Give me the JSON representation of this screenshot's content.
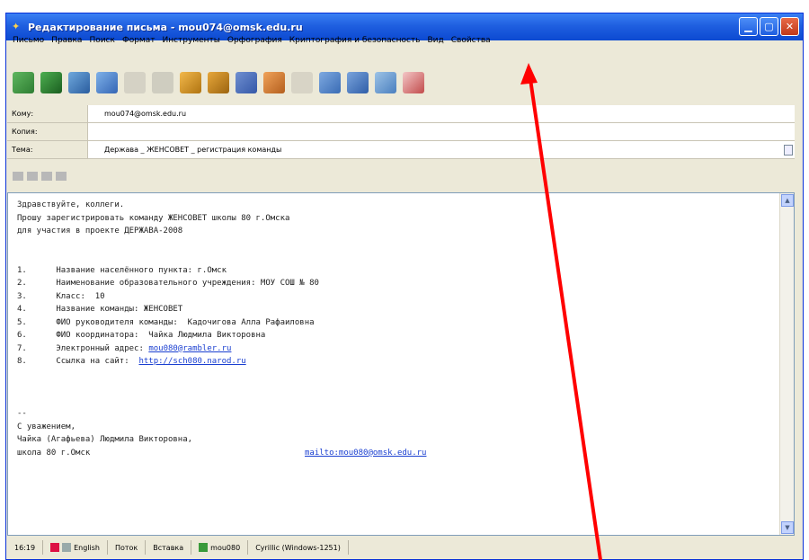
{
  "window": {
    "title": "Редактирование письма - mou074@omsk.edu.ru",
    "controls": [
      "minimize-icon",
      "maximize-icon",
      "close-icon"
    ]
  },
  "menu": [
    "Письмо",
    "Правка",
    "Поиск",
    "Формат",
    "Инструменты",
    "Орфография",
    "Криптография и безопасность",
    "Вид",
    "Свойства"
  ],
  "toolbar": {
    "icons": [
      "send-icon",
      "send-later-icon",
      "address-book-icon",
      "attach-icon",
      "cut-icon",
      "scissors-icon",
      "copy-icon",
      "paste-icon",
      "encrypt-icon",
      "sign-icon",
      "template-icon",
      "insert-icon",
      "file-icon",
      "spell-icon",
      "options-icon"
    ]
  },
  "fields": {
    "to_label": "Кому:",
    "to_value": "mou074@omsk.edu.ru",
    "cc_label": "Копия:",
    "cc_value": "",
    "subject_label": "Тема:",
    "subject_value": "Держава _ ЖЕНСОВЕТ _ регистрация команды"
  },
  "body": {
    "lines": [
      "Здравствуйте, коллеги.",
      "Прошу зарегистрировать команду ЖЕНСОВЕТ школы 80 г.Омска",
      "для участия в проекте ДЕРЖАВА-2008",
      "",
      "",
      "1.      Название населённого пункта: г.Омск",
      "2.      Наименование образовательного учреждения: МОУ СОШ № 80",
      "3.      Класс:  10",
      "4.      Название команды: ЖЕНСОВЕТ",
      "5.      ФИО руководителя команды:  Кадочигова Алла Рафаиловна",
      "6.      ФИО координатора:  Чайка Людмила Викторовна",
      "7.      Электронный адрес: ",
      "8.      Ссылка на сайт:  ",
      "",
      "",
      "",
      "--",
      "С уважением,",
      "Чайка (Агафьева) Людмила Викторовна,",
      "школа 80 г.Омск"
    ],
    "email_link": "mou080@rambler.ru",
    "site_link": "http://sch080.narod.ru",
    "mailto_link": "mailto:mou080@omsk.edu.ru"
  },
  "status": {
    "time": "16:19",
    "language": "English",
    "stream": "Поток",
    "insert": "Вставка",
    "user": "mou080",
    "encoding": "Cyrillic (Windows-1251)"
  },
  "colors": {
    "titlebar": "#1f5fe0",
    "chrome": "#ece9d8",
    "link": "#1a3fd1",
    "annotation_arrow": "#ff0000"
  }
}
